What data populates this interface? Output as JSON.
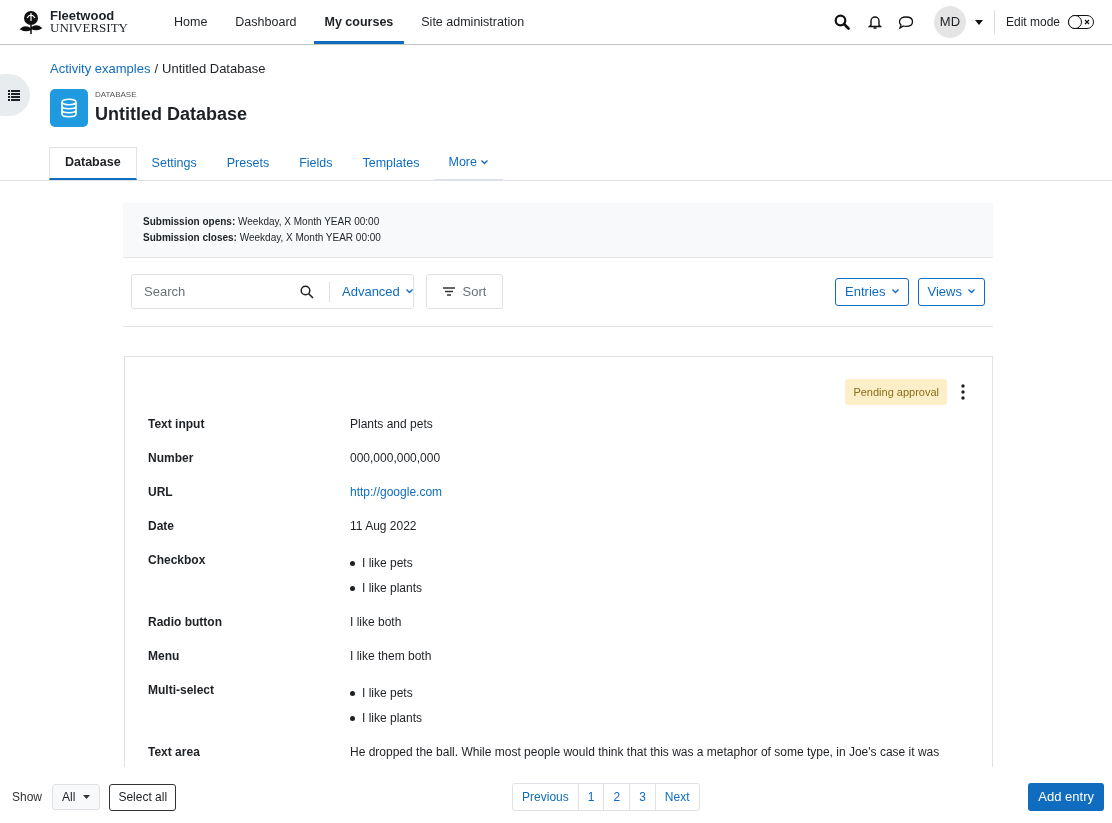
{
  "header": {
    "logo": {
      "line1": "Fleetwood",
      "line2": "UNIVERSITY"
    },
    "nav": [
      {
        "label": "Home",
        "selected": false
      },
      {
        "label": "Dashboard",
        "selected": false
      },
      {
        "label": "My courses",
        "selected": true
      },
      {
        "label": "Site administration",
        "selected": false
      }
    ],
    "avatar": "MD",
    "edit_mode": {
      "label": "Edit mode",
      "on": false
    }
  },
  "breadcrumb": {
    "link": "Activity examples",
    "separator": "/",
    "current": "Untitled Database"
  },
  "activity": {
    "type_label": "DATABASE",
    "title": "Untitled Database"
  },
  "tabs": [
    {
      "label": "Database",
      "selected": true,
      "kind": "tab"
    },
    {
      "label": "Settings",
      "selected": false,
      "kind": "tab"
    },
    {
      "label": "Presets",
      "selected": false,
      "kind": "tab"
    },
    {
      "label": "Fields",
      "selected": false,
      "kind": "tab"
    },
    {
      "label": "Templates",
      "selected": false,
      "kind": "tab"
    },
    {
      "label": "More",
      "selected": false,
      "kind": "menu"
    }
  ],
  "dates": [
    "**Submission opens:** Weekday, X Month YEAR 00:00",
    "**Submission closes:** Weekday, X Month YEAR 00:00"
  ],
  "toolbar": {
    "search_placeholder": "Search",
    "advanced": "Advanced",
    "sort": "Sort",
    "entries": "Entries",
    "views": "Views"
  },
  "entry": {
    "status": "Pending approval",
    "fields": [
      {
        "label": "Text input",
        "kind": "text",
        "value": "Plants and pets"
      },
      {
        "label": "Number",
        "kind": "text",
        "value": "000,000,000,000"
      },
      {
        "label": "URL",
        "kind": "link",
        "value": "http://google.com"
      },
      {
        "label": "Date",
        "kind": "text",
        "value": "11 Aug 2022"
      },
      {
        "label": "Checkbox",
        "kind": "list",
        "items": [
          "I like pets",
          "I like plants"
        ]
      },
      {
        "label": "Radio button",
        "kind": "text",
        "value": "I like both"
      },
      {
        "label": "Menu",
        "kind": "text",
        "value": "I like them both"
      },
      {
        "label": "Multi-select",
        "kind": "list",
        "items": [
          "I like pets",
          "I like plants"
        ]
      },
      {
        "label": "Text area",
        "kind": "text",
        "value": "He dropped the ball. While most people would think that this was a metaphor of some type, in Joe's case it was"
      }
    ]
  },
  "footer": {
    "show_label": "Show",
    "show_value": "All",
    "select_all": "Select all",
    "pages": [
      "Previous",
      "1",
      "2",
      "3",
      "Next"
    ],
    "add_entry": "Add entry"
  }
}
